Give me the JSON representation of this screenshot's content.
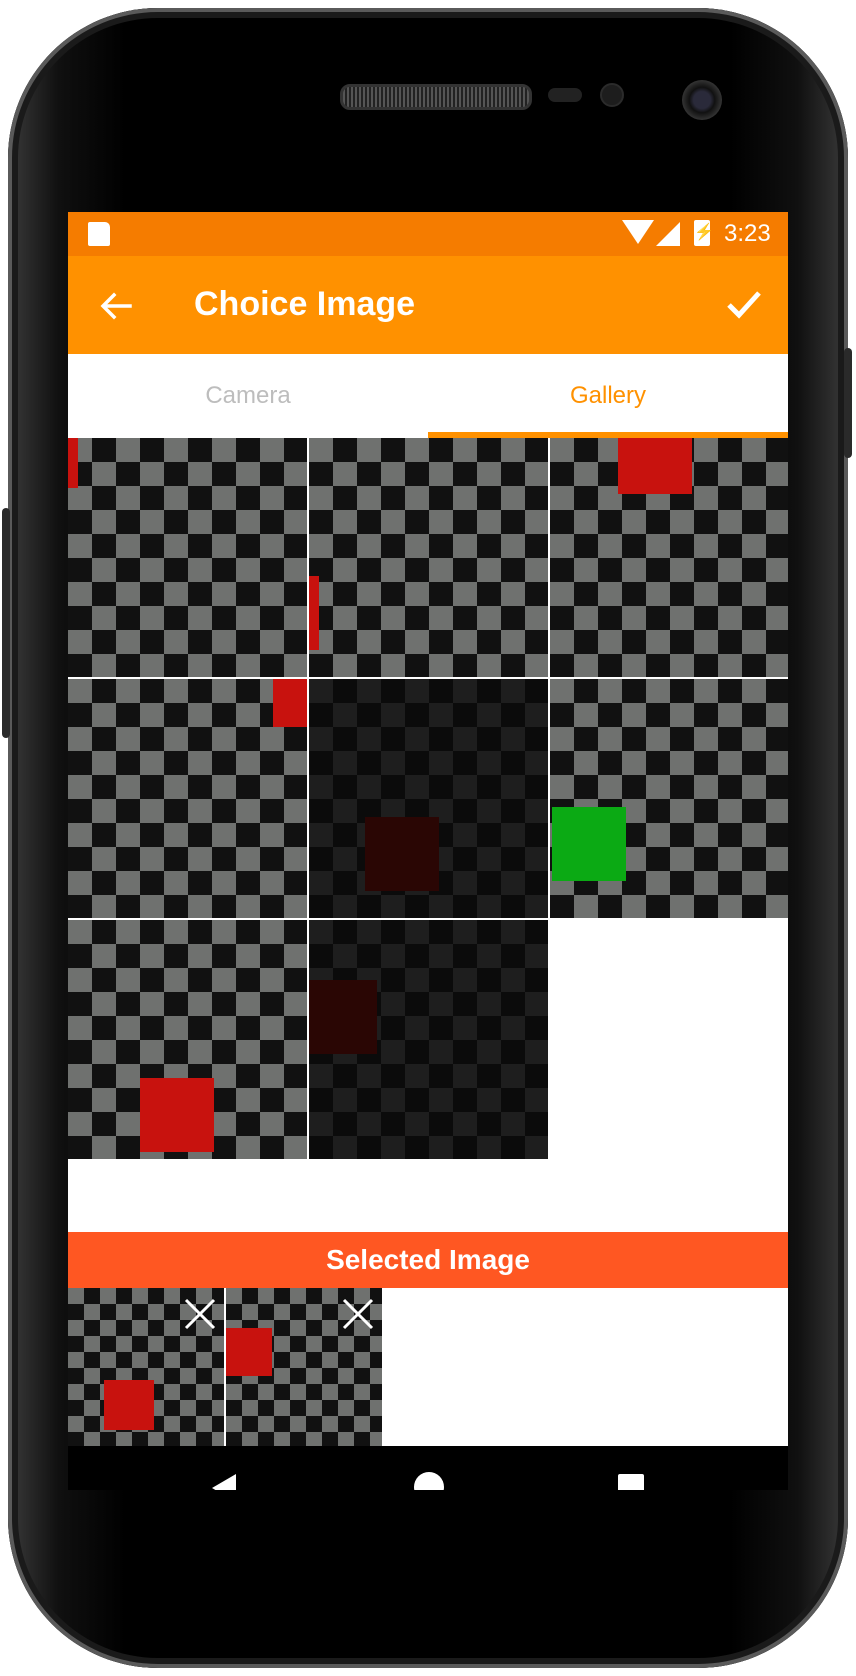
{
  "status_bar": {
    "time": "3:23"
  },
  "app_bar": {
    "title": "Choice Image"
  },
  "tabs": [
    {
      "label": "Camera",
      "selected": false
    },
    {
      "label": "Gallery",
      "selected": true
    }
  ],
  "selected_section": {
    "header": "Selected Image"
  },
  "colors": {
    "status_bar": "#F57C00",
    "app_bar": "#FF9100",
    "accent": "#FF9100",
    "selected_header": "#FF5722",
    "tab_inactive": "#BDBDBD"
  },
  "icons": {
    "back": "arrow-left",
    "confirm": "check",
    "remove": "close-x",
    "status": [
      "sd-card",
      "wifi",
      "cell-signal",
      "battery-charging"
    ],
    "nav": [
      "nav-back-triangle",
      "nav-home-circle",
      "nav-recent-square"
    ]
  },
  "gallery_image_count": 8,
  "selected_image_count": 2
}
